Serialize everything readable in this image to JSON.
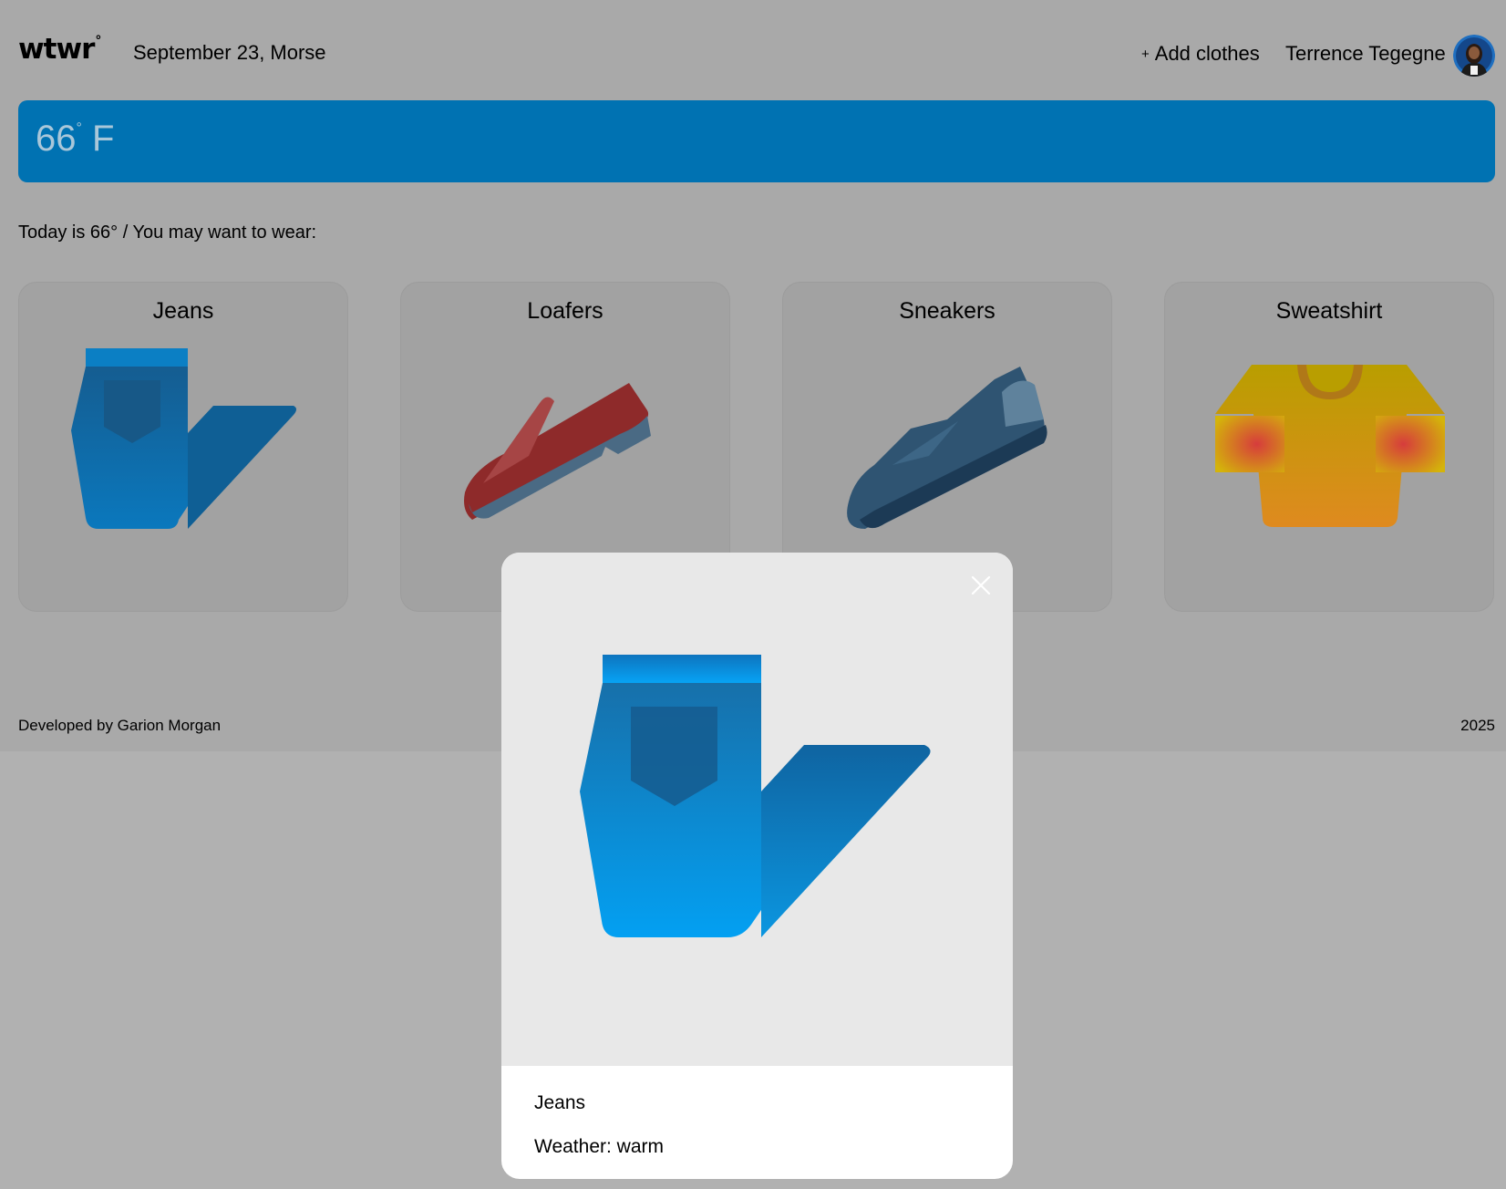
{
  "header": {
    "logo": "wtwr",
    "logo_mark": "°",
    "date_location": "September 23, Morse",
    "add_plus": "+",
    "add_clothes_label": "Add clothes",
    "username": "Terrence Tegegne",
    "avatar_icon": "user-avatar-icon"
  },
  "weather": {
    "temp_value": "66",
    "temp_degree": "°",
    "temp_unit": "F",
    "banner_color": "#0072b2"
  },
  "main": {
    "intro_text": "Today is 66° / You may want to wear:",
    "cards": [
      {
        "title": "Jeans",
        "icon": "jeans-icon"
      },
      {
        "title": "Loafers",
        "icon": "loafer-icon"
      },
      {
        "title": "Sneakers",
        "icon": "sneaker-icon"
      },
      {
        "title": "Sweatshirt",
        "icon": "sweatshirt-icon"
      }
    ]
  },
  "footer": {
    "developer": "Developed by Garion Morgan",
    "year": "2025"
  },
  "modal": {
    "image_icon": "jeans-icon",
    "close_icon": "close-icon",
    "item_name": "Jeans",
    "weather_line": "Weather: warm"
  }
}
